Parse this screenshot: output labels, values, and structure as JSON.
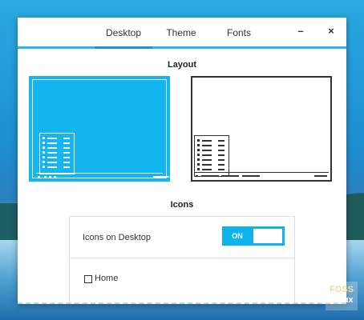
{
  "tabs": [
    {
      "label": "Desktop",
      "active": true
    },
    {
      "label": "Theme",
      "active": false
    },
    {
      "label": "Fonts",
      "active": false
    }
  ],
  "window_buttons": {
    "minimize": "–",
    "close": "×"
  },
  "layout": {
    "title": "Layout",
    "options": [
      {
        "name": "layout-option-1",
        "selected": true
      },
      {
        "name": "layout-option-2",
        "selected": false
      }
    ]
  },
  "icons": {
    "title": "Icons",
    "icons_on_desktop_label": "Icons on Desktop",
    "toggle_state": "ON",
    "home_label": "Home",
    "home_checked": false
  },
  "watermark": {
    "line1": "FOSS",
    "line2": "Linux"
  },
  "colors": {
    "accent": "#14b6ef",
    "accent_dark": "#1a95c9"
  }
}
